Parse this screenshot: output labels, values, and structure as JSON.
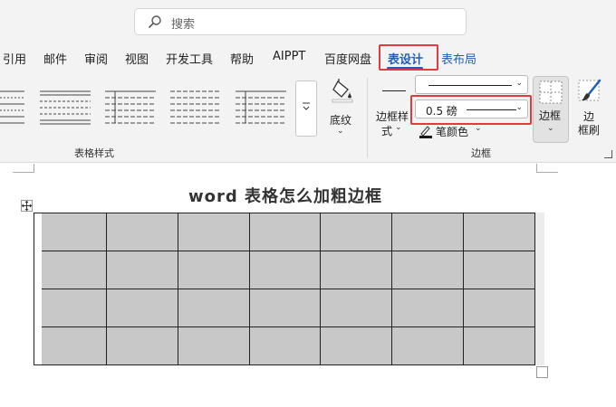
{
  "search": {
    "placeholder": "搜索"
  },
  "tabs": [
    "引用",
    "邮件",
    "审阅",
    "视图",
    "开发工具",
    "帮助",
    "AIPPT",
    "百度网盘",
    "表设计",
    "表布局"
  ],
  "active_tab": "表设计",
  "ribbon": {
    "table_styles_label": "表格样式",
    "shading_label": "底纹",
    "border_styles_label_line1": "边框样",
    "border_styles_label_line2": "式",
    "weight_value": "0.5 磅",
    "pen_color_label": "笔颜色",
    "borders_button_label": "边框",
    "border_painter_line1": "边",
    "border_painter_line2": "框刷",
    "borders_group_label": "边框"
  },
  "colors": {
    "accent": "#1f5fb8",
    "highlight": "#e23b3b",
    "cell_fill": "#c8c8c8",
    "pen_color": "#1a1a1a"
  },
  "document": {
    "title": "word 表格怎么加粗边框",
    "table": {
      "rows": 4,
      "cols": 7
    }
  }
}
